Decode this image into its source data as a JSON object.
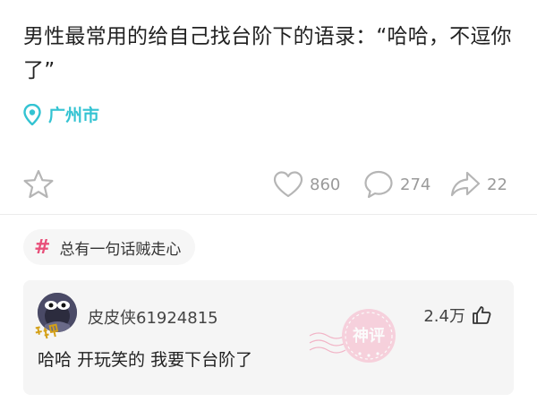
{
  "post": {
    "text": "男性最常用的给自己找台阶下的语录：“哈哈，不逗你了”",
    "location": "广州市"
  },
  "actions": {
    "star_icon": "star-outline",
    "like_icon": "heart-outline",
    "comment_icon": "speech-bubble-outline",
    "share_icon": "share-arrow-outline",
    "like_count": "860",
    "comment_count": "274",
    "share_count": "22"
  },
  "topic": {
    "symbol": "#",
    "label": "总有一句话贼走心"
  },
  "comment": {
    "username": "皮皮侠61924815",
    "likes": "2.4万",
    "text": "哈哈 开玩笑的 我要下台阶了",
    "stamp_label": "神评"
  },
  "colors": {
    "location_accent": "#33c3d2",
    "hash_accent": "#e8507a",
    "stamp_pink": "#f08aa8"
  }
}
